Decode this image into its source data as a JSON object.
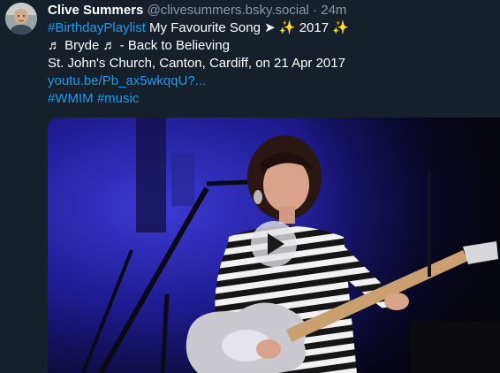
{
  "post": {
    "author_name": "Clive Summers",
    "handle": "@clivesummers.bsky.social",
    "separator": "·",
    "time": "24m",
    "lines": {
      "hashtag_birthday": "#BirthdayPlaylist",
      "line1_rest": " My Favourite Song ➤ ✨ 2017 ✨",
      "line2": "♬ Bryde ♬ - Back to Believing",
      "line3": "St. John's Church, Canton, Cardiff,  on 21 Apr 2017",
      "link": "youtu.be/Pb_ax5wkqqU?...",
      "hashtag_wmim": "#WMIM",
      "hashtag_music": "#music"
    },
    "media": {
      "kind": "video-thumbnail",
      "icon": "play-icon"
    }
  },
  "colors": {
    "background": "#15202b",
    "link": "#1d9bf0",
    "muted": "#8899a6"
  }
}
